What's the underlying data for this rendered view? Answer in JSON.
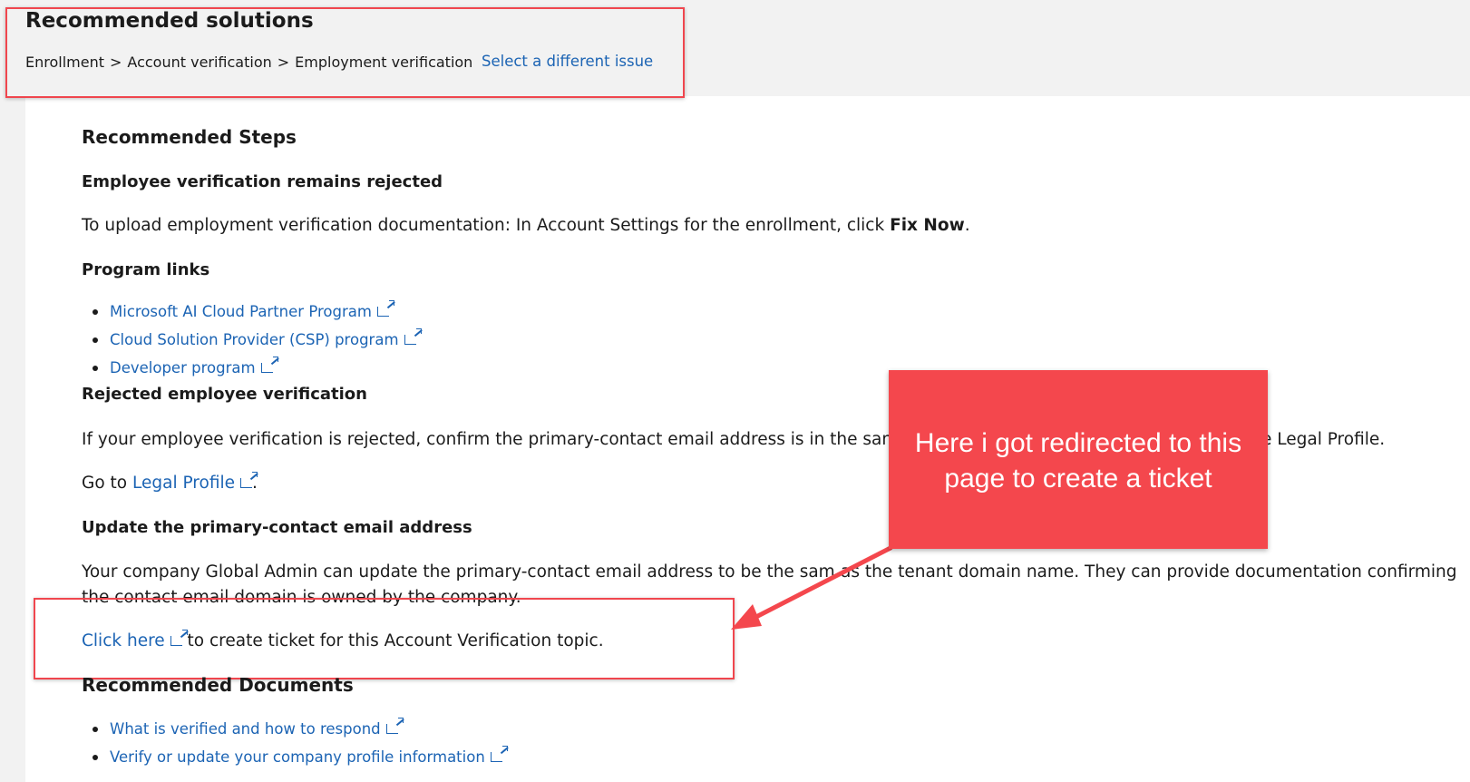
{
  "header": {
    "title": "Recommended solutions",
    "breadcrumb": [
      "Enrollment",
      "Account verification",
      "Employment verification"
    ],
    "breadcrumb_separator": ">",
    "select_issue_label": "Select a different issue"
  },
  "main": {
    "recommended_steps_heading": "Recommended Steps",
    "section1": {
      "heading": "Employee verification remains rejected",
      "text_before": "To upload employment verification documentation: In Account Settings for the enrollment, click ",
      "bold": "Fix Now",
      "text_after": "."
    },
    "program_links": {
      "heading": "Program links",
      "items": [
        "Microsoft AI Cloud Partner Program",
        "Cloud Solution Provider (CSP) program",
        "Developer program"
      ]
    },
    "rejected": {
      "heading": "Rejected employee verification",
      "text_visible_left": "If your employee verification is rejected, confirm the primary-contact email address is in the same",
      "text_visible_right": "e Legal Profile.",
      "goto_prefix": "Go to ",
      "goto_link": "Legal Profile",
      "goto_suffix": "."
    },
    "update_email": {
      "heading": "Update the primary-contact email address",
      "text_line1_left": "Your company Global Admin can update the primary-contact email address to be the sam",
      "text_line1_right": "as the tenant domain name. They can provide documentation confirming",
      "text_line2": "the contact email domain is owned by the company."
    },
    "ticket": {
      "link": "Click here",
      "suffix": " to create ticket for this Account Verification topic."
    },
    "recommended_documents": {
      "heading": "Recommended Documents",
      "items": [
        "What is verified and how to respond",
        "Verify or update your company profile information"
      ]
    }
  },
  "annotation": {
    "callout_line1": "Here i got redirected to this",
    "callout_line2": "page to create a ticket",
    "accent_color": "#f4474d"
  },
  "colors": {
    "link": "#1c64b4",
    "header_bg": "#f2f2f2",
    "text": "#1b1b1b"
  },
  "icons": [
    "external-link-icon"
  ]
}
